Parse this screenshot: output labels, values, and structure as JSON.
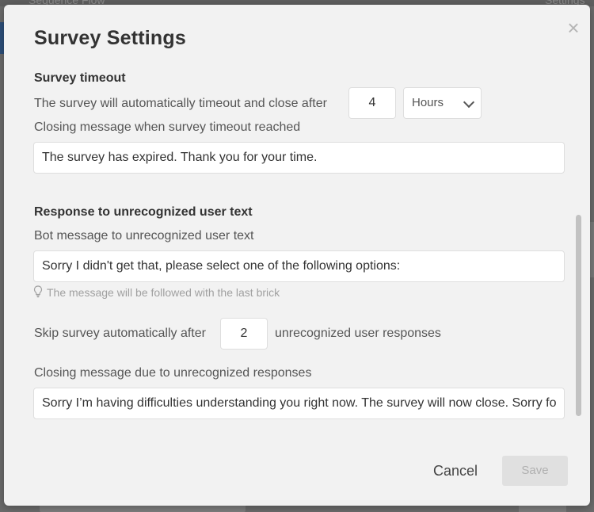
{
  "background": {
    "left_tab": "Sequence Flow",
    "right_tab": "Settings"
  },
  "modal": {
    "title": "Survey Settings",
    "close_icon": "close-icon"
  },
  "timeout": {
    "heading": "Survey timeout",
    "label": "The survey will automatically timeout and close after",
    "value": "4",
    "unit_selected": "Hours",
    "closing_label": "Closing message when survey timeout reached",
    "closing_message": "The survey has expired. Thank you for your time."
  },
  "unrecognized": {
    "heading": "Response to unrecognized user text",
    "bot_label": "Bot message to unrecognized user text",
    "bot_message": "Sorry I didn't get that, please select one of the following options:",
    "hint": "The message will be followed with the last brick",
    "hint_icon": "lightbulb-icon",
    "skip_prefix": "Skip survey automatically after",
    "skip_value": "2",
    "skip_suffix": "unrecognized user responses",
    "closing_label": "Closing message due to unrecognized responses",
    "closing_message": "Sorry I’m having difficulties understanding you right now. The survey will now close. Sorry for any inconvenience."
  },
  "footer": {
    "cancel": "Cancel",
    "save": "Save"
  },
  "colors": {
    "modal_bg": "#f2f2f2",
    "overlay": "#6b6b6b",
    "save_disabled_bg": "#e0e0e0"
  }
}
